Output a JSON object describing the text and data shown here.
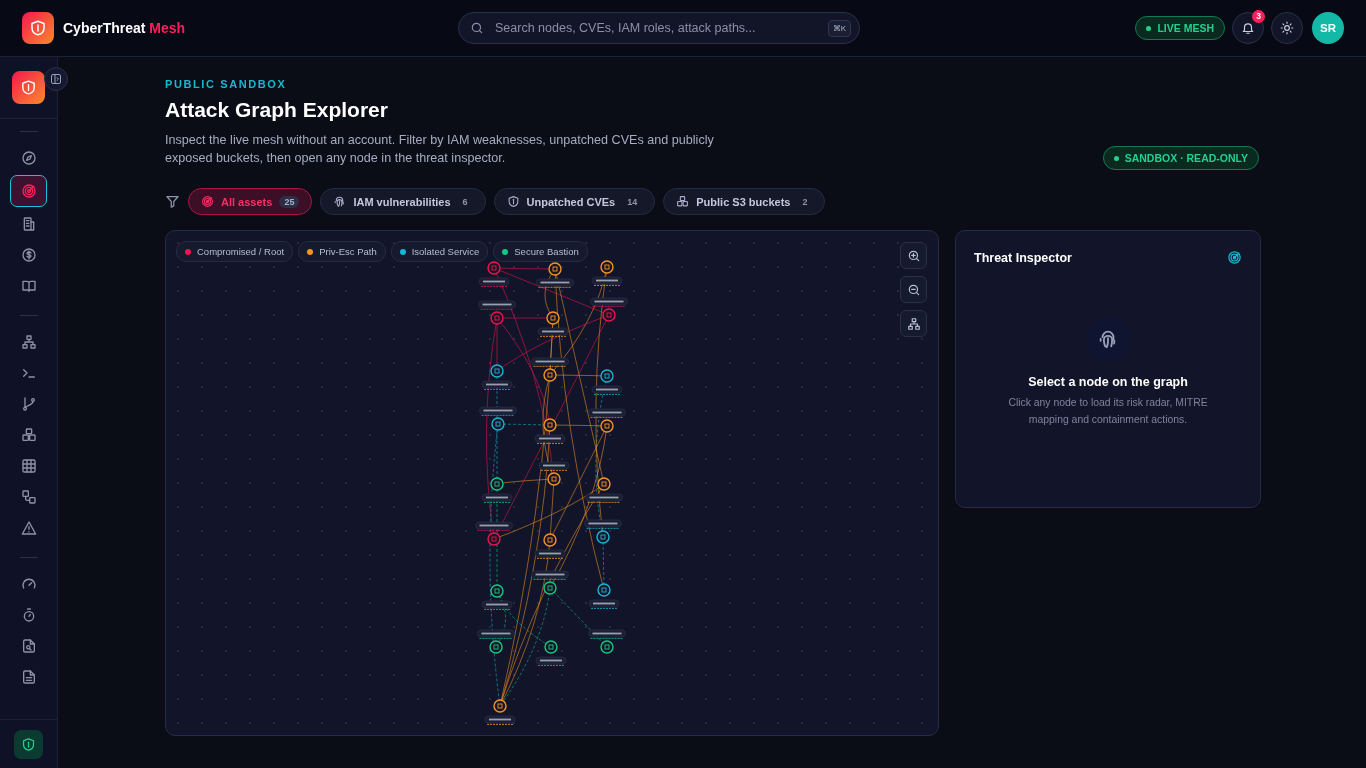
{
  "brand": {
    "name": "CyberThreat",
    "accent": "Mesh"
  },
  "search": {
    "placeholder": "Search nodes, CVEs, IAM roles, attack paths...",
    "shortcut": "⌘K"
  },
  "status": {
    "label": "LIVE MESH"
  },
  "notifications": {
    "count": "3"
  },
  "user": {
    "initials": "SR"
  },
  "sidebar": {
    "groups": [
      [
        {
          "selected": false
        },
        {
          "selected": true
        },
        {
          "selected": false
        },
        {
          "selected": false
        },
        {
          "selected": false
        }
      ],
      [
        {
          "selected": false
        },
        {
          "selected": false
        },
        {
          "selected": false
        },
        {
          "selected": false
        },
        {
          "selected": false
        },
        {
          "selected": false
        },
        {
          "selected": false
        }
      ],
      [
        {
          "selected": false
        },
        {
          "selected": false
        },
        {
          "selected": false
        },
        {
          "selected": false
        }
      ]
    ]
  },
  "page": {
    "eyebrow": "PUBLIC SANDBOX",
    "title": "Attack Graph Explorer",
    "description": "Inspect the live mesh without an account. Filter by IAM weaknesses, unpatched CVEs and publicly exposed buckets, then open any node in the threat inspector.",
    "badge": "SANDBOX · READ-ONLY"
  },
  "filters": [
    {
      "label": "All assets",
      "count": "25",
      "selected": true
    },
    {
      "label": "IAM vulnerabilities",
      "count": "6",
      "selected": false
    },
    {
      "label": "Unpatched CVEs",
      "count": "14",
      "selected": false
    },
    {
      "label": "Public S3 buckets",
      "count": "2",
      "selected": false
    }
  ],
  "graph": {
    "legend": [
      {
        "label": "Compromised / Root",
        "color": "#f0134d"
      },
      {
        "label": "Priv-Esc Path",
        "color": "#f59520"
      },
      {
        "label": "Isolated Service",
        "color": "#14b8d4"
      },
      {
        "label": "Secure Bastion",
        "color": "#12c982"
      }
    ]
  },
  "inspector": {
    "title": "Threat Inspector",
    "empty_title": "Select a node on the graph",
    "empty_text": "Click any node to load its risk radar, MITRE mapping and containment actions."
  }
}
